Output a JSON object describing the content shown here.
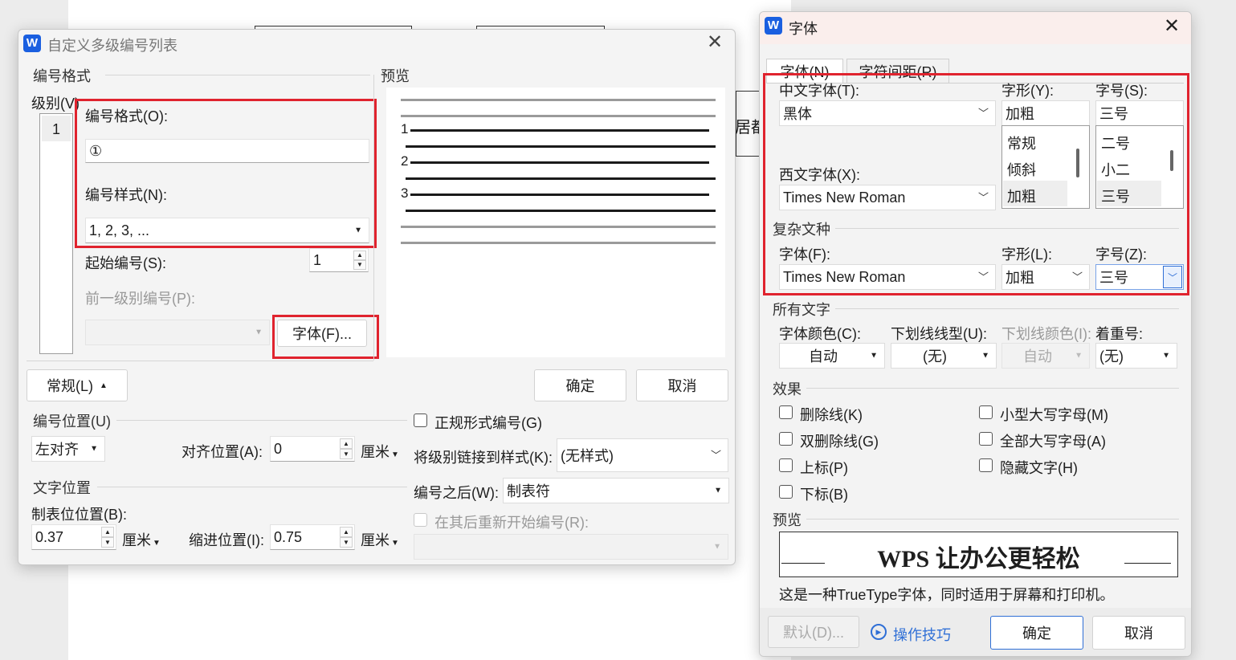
{
  "background_doc": {
    "partial_text": "居都"
  },
  "left_dialog": {
    "title": "自定义多级编号列表",
    "close": "✕",
    "number_format_section": "编号格式",
    "level_label": "级别(V)",
    "levels": [
      "1"
    ],
    "format_label": "编号格式(O):",
    "format_value": "①",
    "style_label": "编号样式(N):",
    "style_value": "1, 2, 3, ...",
    "start_label": "起始编号(S):",
    "start_value": "1",
    "prev_level_label": "前一级别编号(P):",
    "font_button": "字体(F)...",
    "preview_label": "预览",
    "preview_numbers": [
      "1",
      "2",
      "3"
    ],
    "normal_button": "常规(L)",
    "ok_button": "确定",
    "cancel_button": "取消",
    "number_position_section": "编号位置(U)",
    "align_value": "左对齐",
    "align_pos_label": "对齐位置(A):",
    "align_pos_value": "0",
    "unit_cm": "厘米",
    "text_position_section": "文字位置",
    "tab_pos_label": "制表位位置(B):",
    "tab_pos_value": "0.37",
    "indent_label": "缩进位置(I):",
    "indent_value": "0.75",
    "legal_label": "正规形式编号(G)",
    "link_style_label": "将级别链接到样式(K):",
    "link_style_value": "(无样式)",
    "after_number_label": "编号之后(W):",
    "after_number_value": "制表符",
    "restart_label": "在其后重新开始编号(R):"
  },
  "font_dialog": {
    "title": "字体",
    "close": "✕",
    "tabs": [
      "字体(N)",
      "字符间距(R)"
    ],
    "cn_font_label": "中文字体(T):",
    "cn_font_value": "黑体",
    "style_label": "字形(Y):",
    "style_value": "加粗",
    "style_list": [
      "常规",
      "倾斜",
      "加粗"
    ],
    "size_label": "字号(S):",
    "size_value": "三号",
    "size_list": [
      "二号",
      "小二",
      "三号"
    ],
    "west_font_label": "西文字体(X):",
    "west_font_value": "Times New Roman",
    "complex_section": "复杂文种",
    "complex_font_label": "字体(F):",
    "complex_font_value": "Times New Roman",
    "complex_style_label": "字形(L):",
    "complex_style_value": "加粗",
    "complex_size_label": "字号(Z):",
    "complex_size_value": "三号",
    "all_text_section": "所有文字",
    "font_color_label": "字体颜色(C):",
    "font_color_value": "自动",
    "underline_type_label": "下划线线型(U):",
    "underline_type_value": "(无)",
    "underline_color_label": "下划线颜色(I):",
    "underline_color_value": "自动",
    "emphasis_label": "着重号:",
    "emphasis_value": "(无)",
    "effects_section": "效果",
    "effects_left": [
      "删除线(K)",
      "双删除线(G)",
      "上标(P)",
      "下标(B)"
    ],
    "effects_right": [
      "小型大写字母(M)",
      "全部大写字母(A)",
      "隐藏文字(H)"
    ],
    "preview_section": "预览",
    "preview_text": "WPS 让办公更轻松",
    "preview_note": "这是一种TrueType字体，同时适用于屏幕和打印机。",
    "default_button": "默认(D)...",
    "tips_link": "操作技巧",
    "ok_button": "确定",
    "cancel_button": "取消"
  },
  "colors": {
    "accent": "#1a5fe0",
    "highlight_border": "#e0232e",
    "primary_border": "#2f6fd6"
  }
}
